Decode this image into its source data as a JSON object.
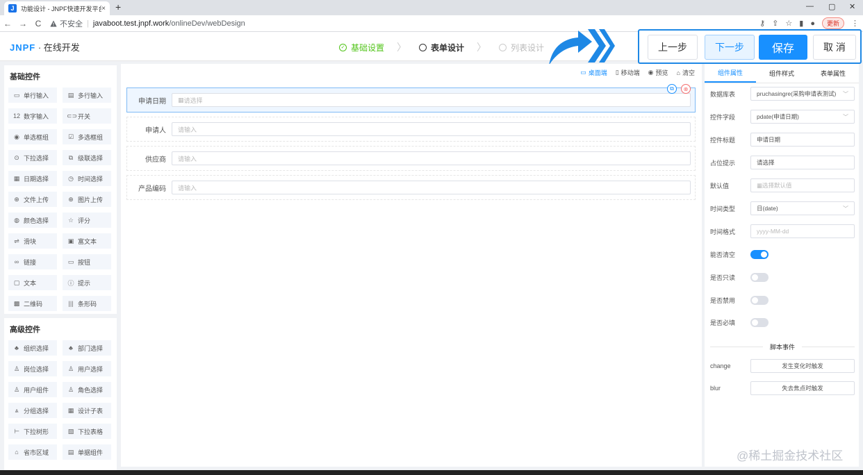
{
  "browser": {
    "tab_title": "功能设计 - JNPF快速开发平台",
    "tab_close": "×",
    "new_tab": "+",
    "insecure_label": "不安全",
    "url_host": "javaboot.test.jnpf.work",
    "url_path": "/onlineDev/webDesign",
    "update_label": "更新",
    "back": "←",
    "forward": "→",
    "reload": "C"
  },
  "header": {
    "logo_brand": "JNPF",
    "logo_sep": " · ",
    "logo_text": "在线开发",
    "steps": [
      {
        "label": "基础设置",
        "state": "done"
      },
      {
        "label": "表单设计",
        "state": "active"
      },
      {
        "label": "列表设计",
        "state": "todo"
      }
    ],
    "buttons": {
      "prev": "上一步",
      "next": "下一步",
      "save": "保存",
      "cancel": "取 消"
    }
  },
  "left": {
    "basic_title": "基础控件",
    "basic_items": [
      {
        "icon": "single-line-input-icon",
        "glyph": "▭",
        "label": "单行输入"
      },
      {
        "icon": "multi-line-input-icon",
        "glyph": "▤",
        "label": "多行输入"
      },
      {
        "icon": "number-input-icon",
        "glyph": "12",
        "label": "数字输入"
      },
      {
        "icon": "switch-icon",
        "glyph": "⊂⊃",
        "label": "开关"
      },
      {
        "icon": "radio-group-icon",
        "glyph": "◉",
        "label": "单选框组"
      },
      {
        "icon": "checkbox-group-icon",
        "glyph": "☑",
        "label": "多选框组"
      },
      {
        "icon": "dropdown-select-icon",
        "glyph": "⊙",
        "label": "下拉选择"
      },
      {
        "icon": "cascader-icon",
        "glyph": "⧉",
        "label": "级联选择"
      },
      {
        "icon": "date-picker-icon",
        "glyph": "▦",
        "label": "日期选择"
      },
      {
        "icon": "time-picker-icon",
        "glyph": "◷",
        "label": "时间选择"
      },
      {
        "icon": "file-upload-icon",
        "glyph": "⊕",
        "label": "文件上传"
      },
      {
        "icon": "image-upload-icon",
        "glyph": "⊕",
        "label": "图片上传"
      },
      {
        "icon": "color-picker-icon",
        "glyph": "◍",
        "label": "颜色选择"
      },
      {
        "icon": "rate-icon",
        "glyph": "☆",
        "label": "评分"
      },
      {
        "icon": "slider-icon",
        "glyph": "⇌",
        "label": "滑块"
      },
      {
        "icon": "rich-text-icon",
        "glyph": "▣",
        "label": "富文本"
      },
      {
        "icon": "link-icon",
        "glyph": "∞",
        "label": "链接"
      },
      {
        "icon": "button-icon",
        "glyph": "▭",
        "label": "按钮"
      },
      {
        "icon": "text-icon",
        "glyph": "▢",
        "label": "文本"
      },
      {
        "icon": "alert-icon",
        "glyph": "ⓘ",
        "label": "提示"
      },
      {
        "icon": "qrcode-icon",
        "glyph": "▩",
        "label": "二维码"
      },
      {
        "icon": "barcode-icon",
        "glyph": "|||",
        "label": "条形码"
      }
    ],
    "advanced_title": "高级控件",
    "advanced_items": [
      {
        "icon": "organization-select-icon",
        "glyph": "♣",
        "label": "组织选择"
      },
      {
        "icon": "department-select-icon",
        "glyph": "♣",
        "label": "部门选择"
      },
      {
        "icon": "position-select-icon",
        "glyph": "♙",
        "label": "岗位选择"
      },
      {
        "icon": "user-select-icon",
        "glyph": "♙",
        "label": "用户选择"
      },
      {
        "icon": "user-component-icon",
        "glyph": "♙",
        "label": "用户组件"
      },
      {
        "icon": "role-select-icon",
        "glyph": "♙",
        "label": "角色选择"
      },
      {
        "icon": "group-select-icon",
        "glyph": "⩓",
        "label": "分组选择"
      },
      {
        "icon": "child-table-icon",
        "glyph": "▦",
        "label": "设计子表"
      },
      {
        "icon": "dropdown-tree-icon",
        "glyph": "⊢",
        "label": "下拉树形"
      },
      {
        "icon": "dropdown-table-icon",
        "glyph": "▧",
        "label": "下拉表格"
      },
      {
        "icon": "region-icon",
        "glyph": "⌂",
        "label": "省市区域"
      },
      {
        "icon": "document-component-icon",
        "glyph": "▤",
        "label": "单据组件"
      }
    ]
  },
  "canvas": {
    "tools": [
      {
        "icon": "desktop-icon",
        "glyph": "▭",
        "label": "桌面端",
        "active": true
      },
      {
        "icon": "mobile-icon",
        "glyph": "▯",
        "label": "移动端",
        "active": false
      },
      {
        "icon": "preview-icon",
        "glyph": "◉",
        "label": "预览",
        "active": false
      },
      {
        "icon": "clear-icon",
        "glyph": "⌂",
        "label": "清空",
        "active": false
      }
    ],
    "fields": [
      {
        "label": "申请日期",
        "placeholder": "请选择",
        "selected": true
      },
      {
        "label": "申请人",
        "placeholder": "请输入",
        "selected": false
      },
      {
        "label": "供应商",
        "placeholder": "请输入",
        "selected": false
      },
      {
        "label": "产品编码",
        "placeholder": "请输入",
        "selected": false
      }
    ]
  },
  "right": {
    "tabs": [
      {
        "label": "组件属性",
        "active": true
      },
      {
        "label": "组件样式",
        "active": false
      },
      {
        "label": "表单属性",
        "active": false
      }
    ],
    "props": [
      {
        "label": "数据库表",
        "value": "pruchasingre(采购申请表测试)",
        "kind": "select"
      },
      {
        "label": "控件字段",
        "value": "pdate(申请日期)",
        "kind": "select"
      },
      {
        "label": "控件标题",
        "value": "申请日期",
        "kind": "input"
      },
      {
        "label": "占位提示",
        "value": "请选择",
        "kind": "input"
      },
      {
        "label": "默认值",
        "value": "选择默认值",
        "kind": "placeholder-date"
      },
      {
        "label": "时间类型",
        "value": "日(date)",
        "kind": "select"
      },
      {
        "label": "时间格式",
        "value": "yyyy-MM-dd",
        "kind": "placeholder"
      }
    ],
    "switches": [
      {
        "label": "能否清空",
        "on": true
      },
      {
        "label": "是否只读",
        "on": false
      },
      {
        "label": "是否禁用",
        "on": false
      },
      {
        "label": "是否必填",
        "on": false
      }
    ],
    "script_title": "脚本事件",
    "events": [
      {
        "label": "change",
        "button": "发生变化时触发"
      },
      {
        "label": "blur",
        "button": "失去焦点时触发"
      }
    ]
  },
  "watermark": "@稀土掘金技术社区"
}
